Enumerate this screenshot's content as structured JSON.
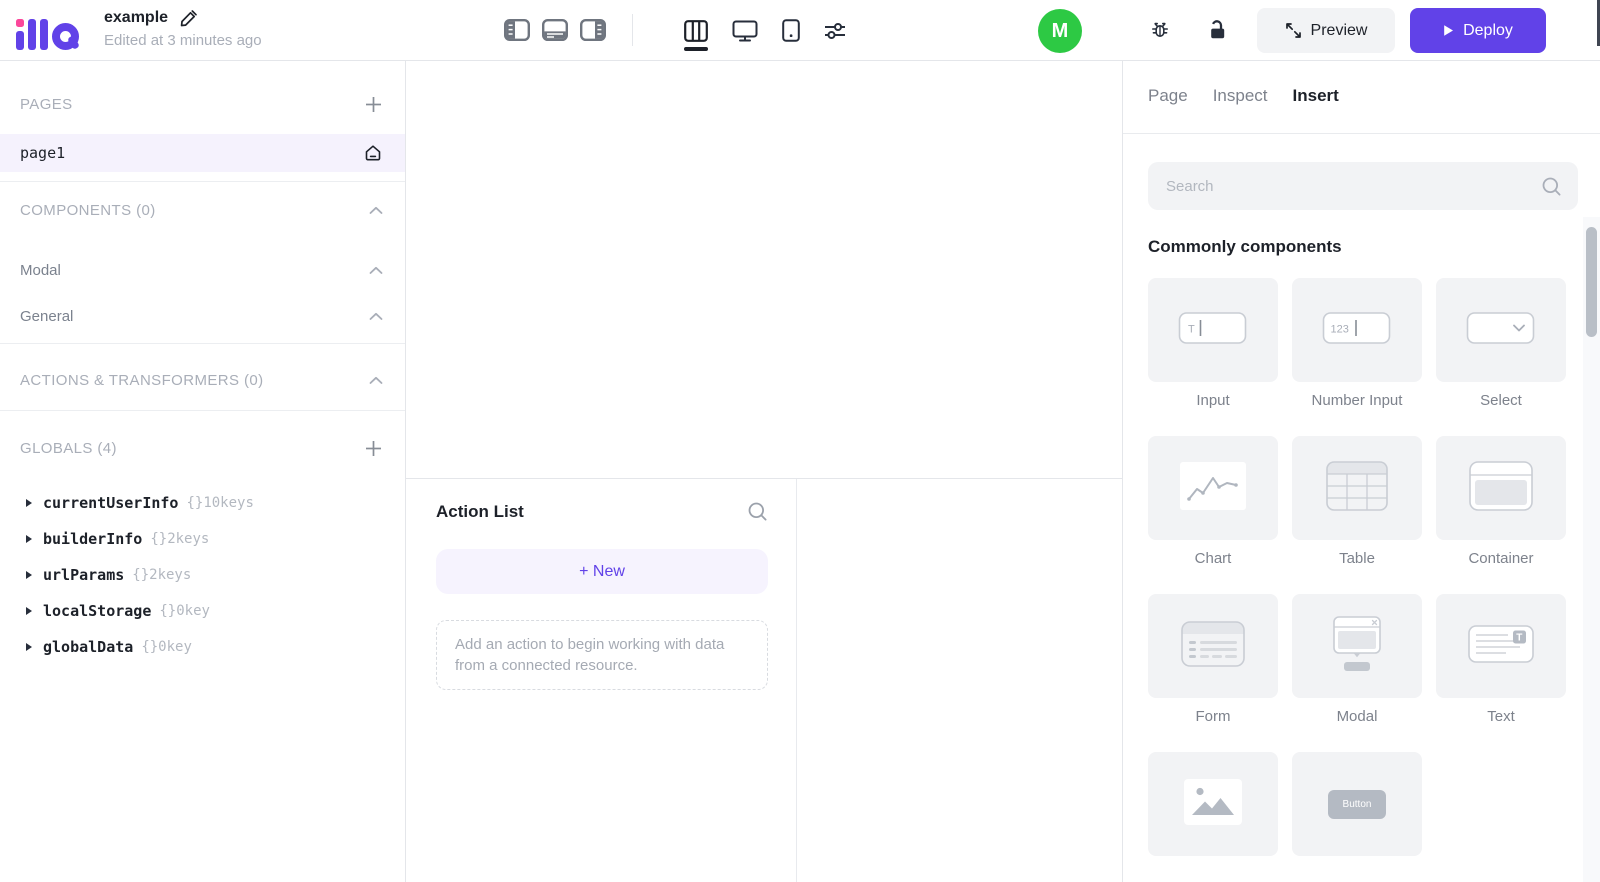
{
  "topbar": {
    "logo_text": "illa",
    "app_name": "example",
    "edited_label": "Edited at 3 minutes ago",
    "avatar_initial": "M",
    "preview_label": "Preview",
    "deploy_label": "Deploy"
  },
  "left_sidebar": {
    "pages_header": "PAGES",
    "page_name": "page1",
    "components_header": "COMPONENTS (0)",
    "modal_group": "Modal",
    "general_group": "General",
    "actions_header": "ACTIONS & TRANSFORMERS (0)",
    "globals_header": "GLOBALS (4)",
    "globals": [
      {
        "name": "currentUserInfo",
        "keys": "{}10keys"
      },
      {
        "name": "builderInfo",
        "keys": "{}2keys"
      },
      {
        "name": "urlParams",
        "keys": "{}2keys"
      },
      {
        "name": "localStorage",
        "keys": "{}0key"
      },
      {
        "name": "globalData",
        "keys": "{}0key"
      }
    ]
  },
  "action_panel": {
    "title": "Action List",
    "new_button_label": "+ New",
    "empty_hint": "Add an action to begin working with data from a connected resource."
  },
  "right_panel": {
    "tab_page": "Page",
    "tab_inspect": "Inspect",
    "tab_insert": "Insert",
    "search_placeholder": "Search",
    "section_title": "Commonly components",
    "components": [
      {
        "icon": "input-icon",
        "label": "Input",
        "icon_text": "T"
      },
      {
        "icon": "number-input-icon",
        "label": "Number Input",
        "icon_text": "123"
      },
      {
        "icon": "select-icon",
        "label": "Select"
      },
      {
        "icon": "chart-icon",
        "label": "Chart"
      },
      {
        "icon": "table-icon",
        "label": "Table"
      },
      {
        "icon": "container-icon",
        "label": "Container"
      },
      {
        "icon": "form-icon",
        "label": "Form"
      },
      {
        "icon": "modal-icon",
        "label": "Modal"
      },
      {
        "icon": "text-icon",
        "label": "Text",
        "icon_text": "T"
      },
      {
        "icon": "image-icon",
        "label": ""
      },
      {
        "icon": "button-icon",
        "label": "",
        "button_text": "Button"
      }
    ]
  },
  "colors": {
    "accent_purple": "#6142e8",
    "purple_light_bg": "#f6f3fe",
    "selected_row_bg": "#f5f2fd",
    "logo_pink": "#fb479b",
    "avatar_green": "#2dc944",
    "border_gray": "#e4e6ea",
    "card_bg": "#f2f3f5"
  }
}
